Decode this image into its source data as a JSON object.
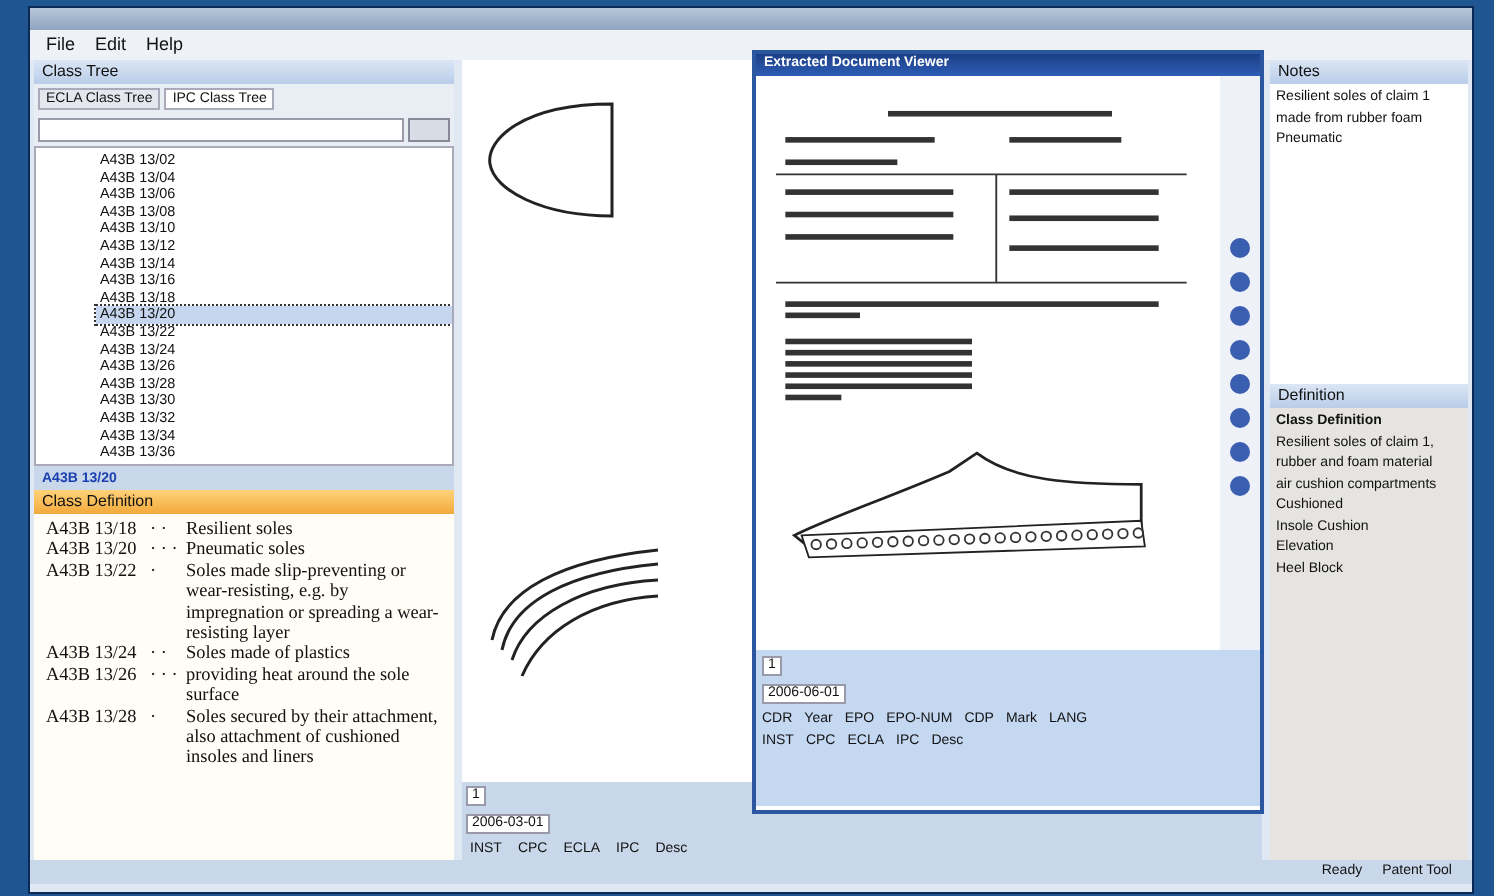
{
  "menu": [
    "File",
    "Edit",
    "Help"
  ],
  "class_tree": {
    "title": "Class Tree",
    "tabs": [
      {
        "label": "ECLA Class Tree",
        "selected": false
      },
      {
        "label": "IPC Class Tree",
        "selected": true
      }
    ],
    "items": [
      {
        "label": "A43B 13/02",
        "selected": false
      },
      {
        "label": "A43B 13/04",
        "selected": false
      },
      {
        "label": "A43B 13/06",
        "selected": false
      },
      {
        "label": "A43B 13/08",
        "selected": false
      },
      {
        "label": "A43B 13/10",
        "selected": false
      },
      {
        "label": "A43B 13/12",
        "selected": false
      },
      {
        "label": "A43B 13/14",
        "selected": false
      },
      {
        "label": "A43B 13/16",
        "selected": false
      },
      {
        "label": "A43B 13/18",
        "selected": false
      },
      {
        "label": "A43B 13/20",
        "selected": true
      },
      {
        "label": "A43B 13/22",
        "selected": false
      },
      {
        "label": "A43B 13/24",
        "selected": false
      },
      {
        "label": "A43B 13/26",
        "selected": false
      },
      {
        "label": "A43B 13/28",
        "selected": false
      },
      {
        "label": "A43B 13/30",
        "selected": false
      },
      {
        "label": "A43B 13/32",
        "selected": false
      },
      {
        "label": "A43B 13/34",
        "selected": false
      },
      {
        "label": "A43B 13/36",
        "selected": false
      }
    ],
    "current_code": "A43B 13/20"
  },
  "class_definition": {
    "title": "Class Definition",
    "rows": [
      {
        "code": "A43B 13/18",
        "dots": "· ·",
        "text": "Resilient soles"
      },
      {
        "code": "A43B 13/20",
        "dots": "· · ·",
        "text": "Pneumatic soles"
      },
      {
        "code": "A43B 13/22",
        "dots": "·",
        "text": "Soles made slip-preventing or wear-resisting, e.g. by impregnation or spreading a wear-resisting layer"
      },
      {
        "code": "A43B 13/24",
        "dots": "· ·",
        "text": "Soles made of plastics"
      },
      {
        "code": "A43B 13/26",
        "dots": "· · ·",
        "text": "providing heat around the sole surface"
      },
      {
        "code": "A43B 13/28",
        "dots": "·",
        "text": "Soles secured by their attachment, also attachment of cushioned insoles and liners"
      }
    ]
  },
  "document": {
    "page": "1",
    "date": "2006-03-01",
    "status": [
      "INST",
      "CPC",
      "ECLA",
      "IPC",
      "Desc"
    ]
  },
  "viewer": {
    "title": "Extracted Document Viewer",
    "page": "1",
    "date": "2006-06-01",
    "tabs": [
      "CDR",
      "Year",
      "EPO",
      "EPO-NUM",
      "CDP",
      "Mark",
      "LANG"
    ],
    "fields": [
      "INST",
      "CPC",
      "ECLA",
      "IPC",
      "Desc"
    ]
  },
  "notes": {
    "title": "Notes",
    "lines": [
      "Resilient soles of claim 1",
      "made from rubber foam",
      "Pneumatic"
    ]
  },
  "definition_panel": {
    "title": "Definition",
    "heading": "Class Definition",
    "lines": [
      "Resilient soles of claim 1,",
      "rubber and foam material",
      "air cushion compartments",
      "Cushioned",
      "Insole Cushion",
      "Elevation",
      "Heel Block"
    ]
  },
  "status_bar": [
    "Ready",
    "Patent Tool"
  ]
}
